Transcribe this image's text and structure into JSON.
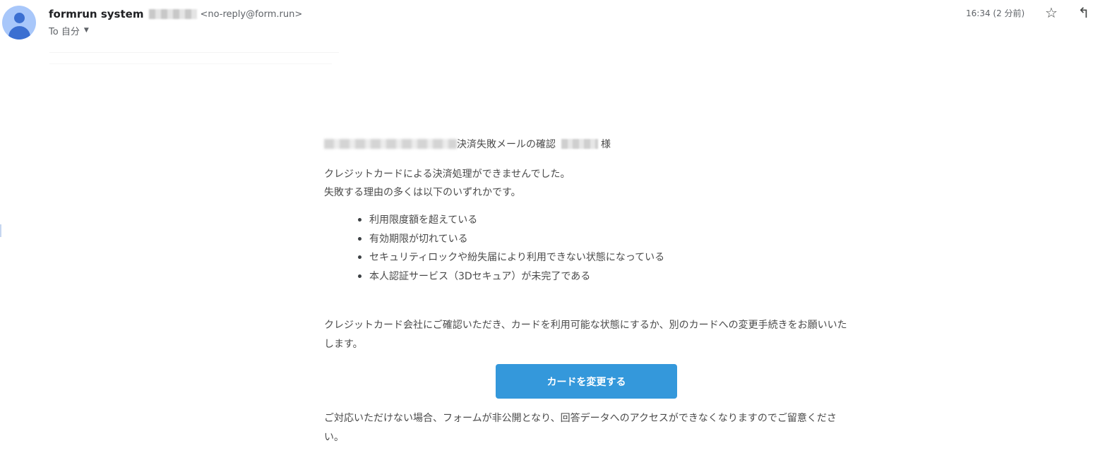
{
  "header": {
    "sender_name": "formrun system",
    "sender_email": "<no-reply@form.run>",
    "recipient": "To 自分",
    "timestamp": "16:34 (2 分前)",
    "icons": {
      "avatar": "default-avatar-icon",
      "star": "star-icon",
      "reply": "reply-icon",
      "recipient_caret": "caret-down-icon"
    }
  },
  "body": {
    "greeting_subject": "決済失敗メールの確認",
    "greeting_suffix": "様",
    "intro_line1": "クレジットカードによる決済処理ができませんでした。",
    "intro_line2": "失敗する理由の多くは以下のいずれかです。",
    "reasons": [
      "利用限度額を超えている",
      "有効期限が切れている",
      "セキュリティロックや紛失届により利用できない状態になっている",
      "本人認証サービス（3Dセキュア）が未完了である"
    ],
    "request": "クレジットカード会社にご確認いただき、カードを利用可能な状態にするか、別のカードへの変更手続きをお願いいたします。",
    "button_label": "カードを変更する",
    "notice": "ご対応いただけない場合、フォームが非公開となり、回答データへのアクセスができなくなりますのでご留意ください。"
  },
  "colors": {
    "button_bg": "#3498db",
    "button_text": "#ffffff",
    "avatar_bg": "#a8c7fa",
    "avatar_fg": "#3b6fd1"
  }
}
